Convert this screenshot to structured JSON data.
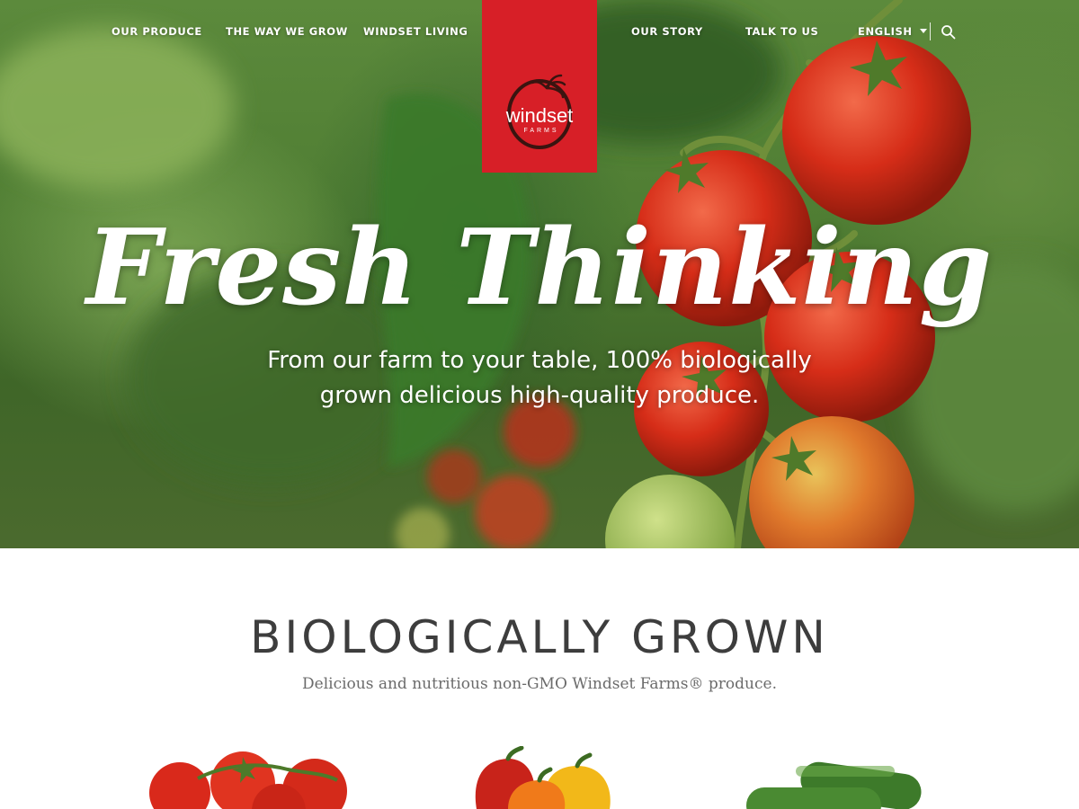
{
  "nav": {
    "left": [
      {
        "label": "OUR PRODUCE"
      },
      {
        "label": "THE WAY WE GROW"
      },
      {
        "label": "WINDSET LIVING"
      }
    ],
    "right": [
      {
        "label": "OUR STORY"
      },
      {
        "label": "TALK TO US"
      }
    ],
    "language": "ENGLISH",
    "search_icon": "search-icon"
  },
  "logo": {
    "brand": "windset",
    "sub": "FARMS",
    "color": "#d71f27"
  },
  "hero": {
    "title": "Fresh Thinking",
    "subtitle_line1": "From our farm to your table, 100% biologically",
    "subtitle_line2": "grown delicious high-quality produce."
  },
  "section": {
    "title": "BIOLOGICALLY GROWN",
    "subtitle": "Delicious and nutritious non-GMO Windset Farms® produce."
  },
  "produce": [
    {
      "icon": "tomatoes-image"
    },
    {
      "icon": "peppers-image"
    },
    {
      "icon": "cucumbers-image"
    }
  ]
}
